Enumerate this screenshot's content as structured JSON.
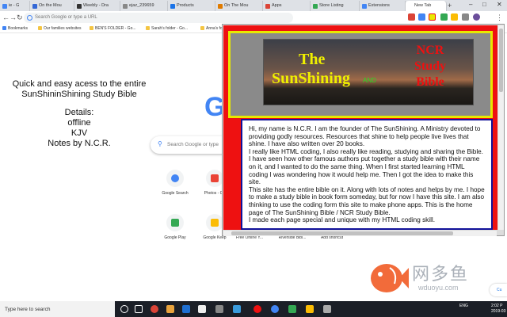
{
  "browser": {
    "tabs": [
      {
        "label": "ie - G",
        "color": "#4285f4"
      },
      {
        "label": "On the Mou",
        "color": "#3367d6"
      },
      {
        "label": "Weebly - Dra",
        "color": "#333333"
      },
      {
        "label": "ejaz_239659",
        "color": "#888888"
      },
      {
        "label": "Products",
        "color": "#1a73e8"
      },
      {
        "label": "On The Mou",
        "color": "#e07b00"
      },
      {
        "label": "Apps",
        "color": "#db4437"
      },
      {
        "label": "Store Listing",
        "color": "#34a853"
      },
      {
        "label": "Extensions",
        "color": "#4285f4"
      },
      {
        "label": "New Tab",
        "color": "#ffffff"
      }
    ],
    "new_tab_symbol": "+",
    "window_controls": [
      "–",
      "□",
      "✕"
    ],
    "nav_icons": [
      "←",
      "→",
      "↻"
    ],
    "address_placeholder": "Search Google or type a URL",
    "bookmarks": [
      {
        "label": "Bookmarks"
      },
      {
        "label": "Our families websites"
      },
      {
        "label": "BEN'S FOLDER - Go..."
      },
      {
        "label": "Sarah's folder - Go..."
      },
      {
        "label": "Anna's fo"
      }
    ]
  },
  "ntp": {
    "search_placeholder": "Search Google or type",
    "shortcuts_row1": [
      {
        "label": "Google Search",
        "color": "#4285f4"
      },
      {
        "label": "Photos - Go",
        "color": "#ea4335"
      }
    ],
    "shortcuts_row2": [
      {
        "label": "Google Play",
        "color": "#34a853"
      },
      {
        "label": "Google Keep",
        "color": "#fbbc04"
      },
      {
        "label": "Free Online Y...",
        "color": "#888888"
      },
      {
        "label": "Riverside Bibl...",
        "color": "#888888"
      },
      {
        "label": "Add shortcut",
        "color": "#cccccc"
      }
    ],
    "customize_label": "Cu"
  },
  "info": {
    "line1": "Quick and easy acess to the entire",
    "line2": "SunShininShining Study Bible",
    "details_heading": "Details:",
    "detail1": "offline",
    "detail2": "KJV",
    "detail3": "Notes by N.C.R."
  },
  "popup": {
    "banner": {
      "the": "The",
      "sunshining": "SunShining",
      "and": "AND",
      "ncr": "NCR",
      "study": "Study",
      "bible": "Bible"
    },
    "paragraphs": [
      "Hi, my name is N.C.R. I am the founder of The SunShining. A Ministry devoted to providing godly resources. Resources that shine to help people live lives that shine. I have also written over 20 books.",
      "I really like HTML coding, I also really like reading, studying and sharing the Bible. I have seen how other famous authors put together a study bible with their name on it, and I wanted to do the same thing. When I first started learning HTML coding I was wondering how it would help me. Then I got the idea to make this site.",
      "This site has the entire bible on it. Along with lots of notes and helps by me. I hope to make a study bible in book form someday, but for now I have this site. I am also thinking to use the coding form this site to make phone apps. This is the home page of The SunShining Bible / NCR Study Bible.",
      "I made each page special and unique with my HTML coding skill."
    ]
  },
  "watermark": {
    "cn": "网多鱼",
    "url": "wduoyu.com"
  },
  "taskbar": {
    "search_placeholder": "Type here to search",
    "tray": "ENG",
    "time": "2:02 P",
    "date": "2019-03"
  },
  "colors": {
    "popup_red": "#ee1111",
    "header_border": "#e8e800",
    "body_border": "#111199",
    "banner_text": "#f0f000",
    "banner_ncr": "#ee1111"
  }
}
